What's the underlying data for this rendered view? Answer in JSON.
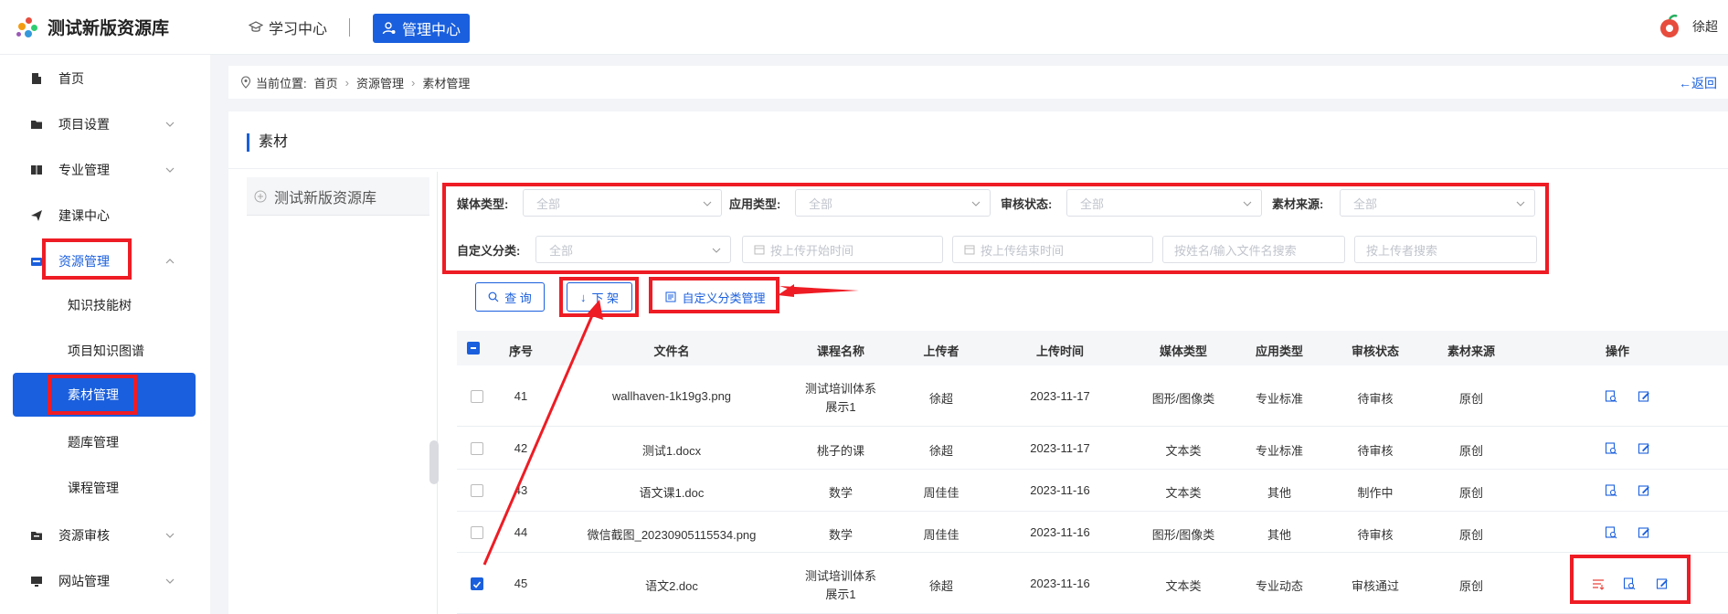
{
  "header": {
    "logo_text": "测试新版资源库",
    "nav_learning": "学习中心",
    "nav_admin": "管理中心",
    "user_name": "徐超"
  },
  "sidebar": {
    "items": [
      {
        "label": "首页"
      },
      {
        "label": "项目设置"
      },
      {
        "label": "专业管理"
      },
      {
        "label": "建课中心"
      },
      {
        "label": "资源管理"
      },
      {
        "label": "资源审核"
      },
      {
        "label": "网站管理"
      }
    ],
    "sub_items": [
      {
        "label": "知识技能树"
      },
      {
        "label": "项目知识图谱"
      },
      {
        "label": "素材管理"
      },
      {
        "label": "题库管理"
      },
      {
        "label": "课程管理"
      }
    ]
  },
  "breadcrumb": {
    "prefix": "当前位置:",
    "items": [
      "首页",
      "资源管理",
      "素材管理"
    ],
    "back": "返回"
  },
  "panel": {
    "title": "素材",
    "tree_root": "测试新版资源库"
  },
  "filters": {
    "media_type_label": "媒体类型:",
    "media_type_value": "全部",
    "app_type_label": "应用类型:",
    "app_type_value": "全部",
    "review_status_label": "审核状态:",
    "review_status_value": "全部",
    "source_label": "素材来源:",
    "source_value": "全部",
    "custom_category_label": "自定义分类:",
    "custom_category_value": "全部",
    "start_time_placeholder": "按上传开始时间",
    "end_time_placeholder": "按上传结束时间",
    "name_search_placeholder": "按姓名/输入文件名搜索",
    "uploader_search_placeholder": "按上传者搜索"
  },
  "actions": {
    "query": "查 询",
    "take_down": "下 架",
    "custom_category_manage": "自定义分类管理"
  },
  "table": {
    "headers": [
      "序号",
      "文件名",
      "课程名称",
      "上传者",
      "上传时间",
      "媒体类型",
      "应用类型",
      "审核状态",
      "素材来源",
      "操作"
    ],
    "rows": [
      {
        "no": "41",
        "file": "wallhaven-1k19g3.png",
        "course_line1": "测试培训体系",
        "course_line2": "展示1",
        "uploader": "徐超",
        "time": "2023-11-17",
        "media": "图形/图像类",
        "app": "专业标准",
        "status": "待审核",
        "source": "原创",
        "checked": false
      },
      {
        "no": "42",
        "file": "测试1.docx",
        "course_line1": "桃子的课",
        "course_line2": "",
        "uploader": "徐超",
        "time": "2023-11-17",
        "media": "文本类",
        "app": "专业标准",
        "status": "待审核",
        "source": "原创",
        "checked": false
      },
      {
        "no": "43",
        "file": "语文课1.doc",
        "course_line1": "数学",
        "course_line2": "",
        "uploader": "周佳佳",
        "time": "2023-11-16",
        "media": "文本类",
        "app": "其他",
        "status": "制作中",
        "source": "原创",
        "checked": false
      },
      {
        "no": "44",
        "file": "微信截图_20230905115534.png",
        "course_line1": "数学",
        "course_line2": "",
        "uploader": "周佳佳",
        "time": "2023-11-16",
        "media": "图形/图像类",
        "app": "其他",
        "status": "待审核",
        "source": "原创",
        "checked": false
      },
      {
        "no": "45",
        "file": "语文2.doc",
        "course_line1": "测试培训体系",
        "course_line2": "展示1",
        "uploader": "徐超",
        "time": "2023-11-16",
        "media": "文本类",
        "app": "专业动态",
        "status": "审核通过",
        "source": "原创",
        "checked": true
      }
    ]
  },
  "colors": {
    "primary": "#1a5fdd",
    "annotation": "#ee1c24",
    "take_down_icon": "#e9423a"
  }
}
